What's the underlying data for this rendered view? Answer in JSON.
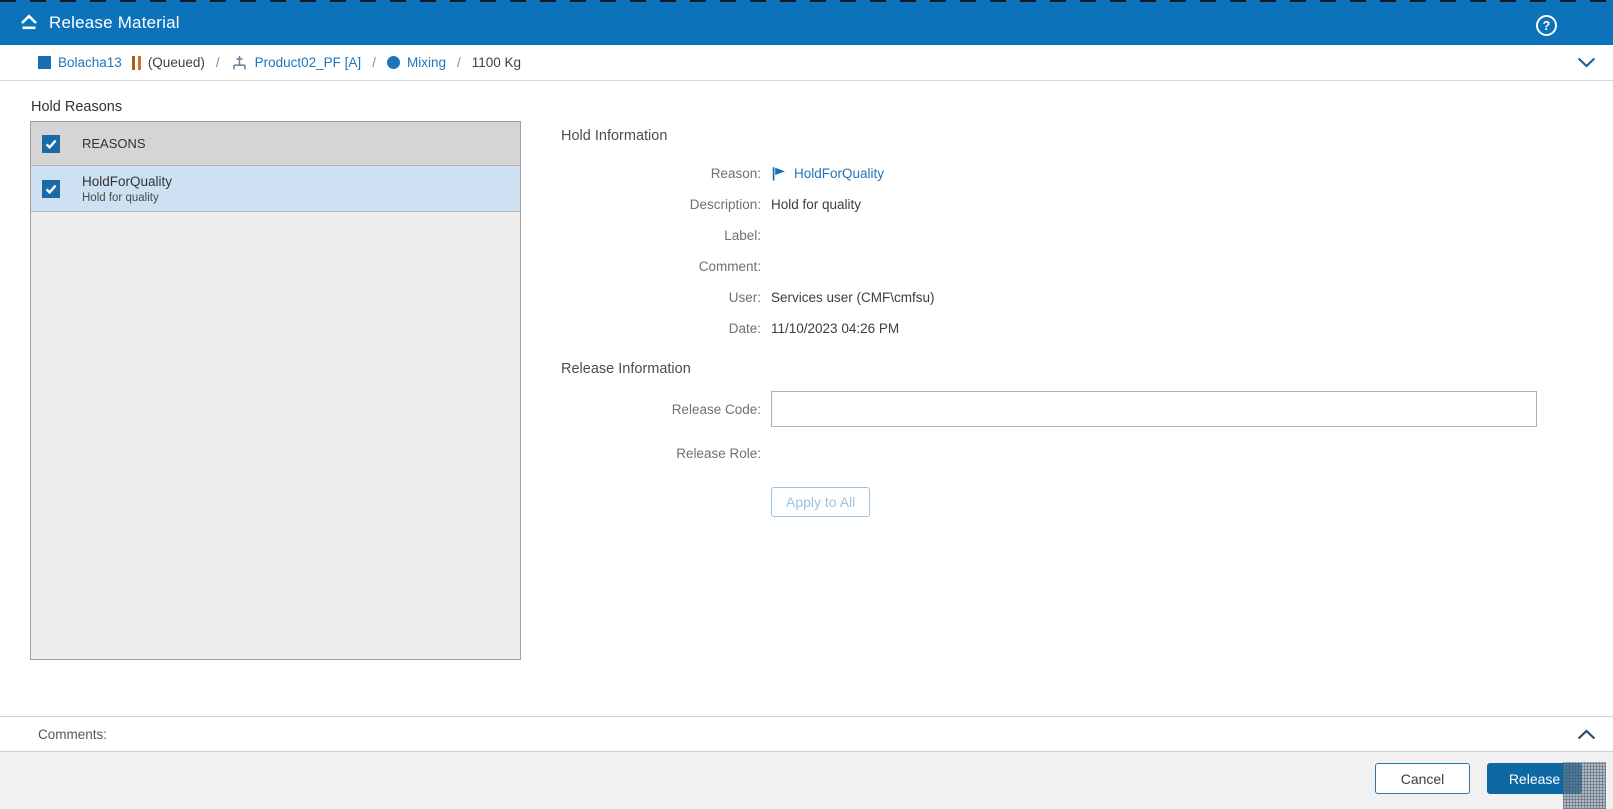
{
  "window": {
    "title": "Release Material"
  },
  "header": {
    "help_icon": "?"
  },
  "breadcrumb": {
    "material_name": "Bolacha13",
    "state": "(Queued)",
    "separator": "/",
    "product_name": "Product02_PF [A]",
    "flow_step": "Mixing",
    "quantity": "1100 Kg"
  },
  "hold_reasons": {
    "section_label": "Hold Reasons",
    "table_header": "REASONS",
    "rows": [
      {
        "name": "HoldForQuality",
        "description": "Hold for quality",
        "checked": true
      }
    ],
    "select_all_checked": true
  },
  "hold_information": {
    "section_title": "Hold Information",
    "fields": [
      {
        "label": "Reason:",
        "value": "HoldForQuality"
      },
      {
        "label": "Description:",
        "value": "Hold for quality"
      },
      {
        "label": "Label:",
        "value": ""
      },
      {
        "label": "Comment:",
        "value": ""
      },
      {
        "label": "User:",
        "value": "Services user (CMF\\cmfsu)"
      },
      {
        "label": "Date:",
        "value": "11/10/2023 04:26 PM"
      }
    ]
  },
  "release_information": {
    "section_title": "Release Information",
    "release_code": {
      "label": "Release Code:",
      "value": ""
    },
    "release_role": {
      "label": "Release Role:",
      "value": ""
    },
    "apply_to_all_label": "Apply to All"
  },
  "comments": {
    "label": "Comments:"
  },
  "footer": {
    "cancel_label": "Cancel",
    "release_label": "Release"
  },
  "colors": {
    "header_blue": "#0c72ba",
    "link_blue": "#1d75ba",
    "checkbox_blue": "#1a6aa5",
    "selected_row_blue": "#cde1f2",
    "table_header_gray": "#d5d5d5",
    "panel_gray": "#ededed",
    "footer_gray": "#f1f1f1",
    "release_button_blue": "#0e68a4",
    "pause_orange": "#c06018"
  },
  "icons": {
    "eject-icon": "collapse dialog chevron with bar",
    "help-icon": "question mark in circle",
    "material-square-icon": "blue filled square",
    "pause-icon": "two orange vertical bars (queued state)",
    "product-icon": "flow/BOM junction glyph",
    "step-circle-icon": "blue filled circle",
    "chevron-down-icon": "expand breadcrumb",
    "checkbox-check-icon": "white check mark",
    "flag-icon": "blue pennant flag",
    "chevron-up-icon": "collapse comments"
  }
}
